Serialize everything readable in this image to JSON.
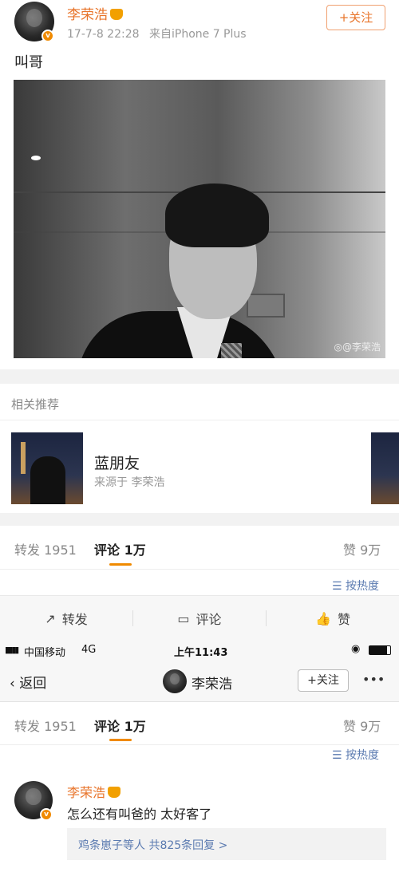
{
  "post": {
    "username": "李荣浩",
    "date": "17-7-8 22:28",
    "source": "来自iPhone 7 Plus",
    "follow_label": "+关注",
    "text": "叫哥",
    "photo_watermark": "@李荣浩",
    "badge_letter": "v"
  },
  "related": {
    "section_title": "相关推荐",
    "item_title": "蓝朋友",
    "item_source": "来源于 李荣浩"
  },
  "tabs": {
    "repost": "转发 1951",
    "comment": "评论 1万",
    "like": "赞 9万",
    "sort": "按热度"
  },
  "actions": {
    "repost": "转发",
    "comment": "评论",
    "like": "赞"
  },
  "status_bar": {
    "carrier": "中国移动",
    "network": "4G",
    "time": "上午11:43"
  },
  "nav": {
    "back": "返回",
    "title": "李荣浩",
    "follow": "+关注",
    "more": "•••"
  },
  "comment": {
    "username": "李荣浩",
    "text": "怎么还有叫爸的 太好客了",
    "replies": "鸡条崽子等人  共825条回复 >"
  },
  "colors": {
    "accent": "#e8742a",
    "badge": "#f08a00",
    "link": "#5a7ab0"
  }
}
